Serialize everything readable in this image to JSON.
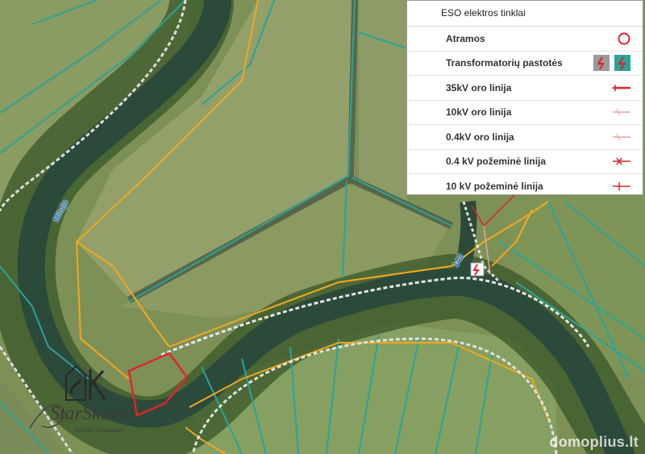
{
  "legend": {
    "title": "ESO elektros tinklai",
    "items": [
      {
        "label": "Atramos",
        "icon": "circle-icon",
        "color": "#e0252a"
      },
      {
        "label": "Transformatorių pastotės",
        "icon": "substation-icon",
        "color": "#e0252a"
      },
      {
        "label": "35kV oro linija",
        "icon": "line-35kv-icon",
        "color": "#e0252a"
      },
      {
        "label": "10kV oro linija",
        "icon": "line-10kv-icon",
        "color": "#e8a0a0"
      },
      {
        "label": "0.4kV oro linija",
        "icon": "line-04kv-icon",
        "color": "#e8a0a0"
      },
      {
        "label": "0.4 kV požeminė linija",
        "icon": "underground-04kv-icon",
        "color": "#e0252a"
      },
      {
        "label": "10 kV požeminė linija",
        "icon": "underground-10kv-icon",
        "color": "#e0252a"
      }
    ]
  },
  "map": {
    "river_label": "Mituja",
    "road_label": "142",
    "watermark": "domoplius.lt",
    "logo_text": "StarSkovas",
    "logo_tagline": "SKAITAI | ŠENMINGAI"
  },
  "colors": {
    "parcel_teal": "#2aa39a",
    "parcel_orange": "#f2a81d",
    "highlight_red": "#e0252a",
    "river": "#2c4a3a"
  }
}
